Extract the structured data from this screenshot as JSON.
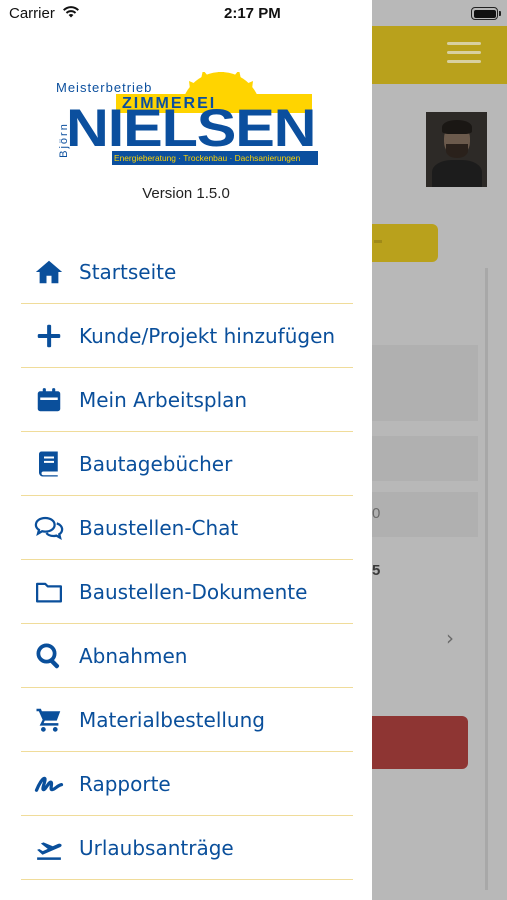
{
  "status_bar": {
    "carrier": "Carrier",
    "time": "2:17 PM"
  },
  "logo": {
    "line1": "Meisterbetrieb",
    "line2": "ZIMMEREI",
    "side": "Björn",
    "name": "NIELSEN",
    "tagline": "Energieberatung · Trockenbau · Dachsanierungen"
  },
  "version": "Version 1.5.0",
  "menu": {
    "items": [
      {
        "label": "Startseite",
        "icon": "home-icon"
      },
      {
        "label": "Kunde/Projekt hinzufügen",
        "icon": "plus-icon"
      },
      {
        "label": "Mein Arbeitsplan",
        "icon": "calendar-icon"
      },
      {
        "label": "Bautagebücher",
        "icon": "book-icon"
      },
      {
        "label": "Baustellen-Chat",
        "icon": "chat-icon"
      },
      {
        "label": "Baustellen-Dokumente",
        "icon": "folder-icon"
      },
      {
        "label": "Abnahmen",
        "icon": "search-icon"
      },
      {
        "label": "Materialbestellung",
        "icon": "cart-icon"
      },
      {
        "label": "Rapporte",
        "icon": "signature-icon"
      },
      {
        "label": "Urlaubsanträge",
        "icon": "flight-takeoff-icon"
      }
    ]
  },
  "background": {
    "digit1": "0",
    "digit2": "5",
    "chevron": "›"
  },
  "colors": {
    "accent_blue": "#0a4f9b",
    "brand_yellow": "#ffd400",
    "divider": "#f0dc9a"
  }
}
